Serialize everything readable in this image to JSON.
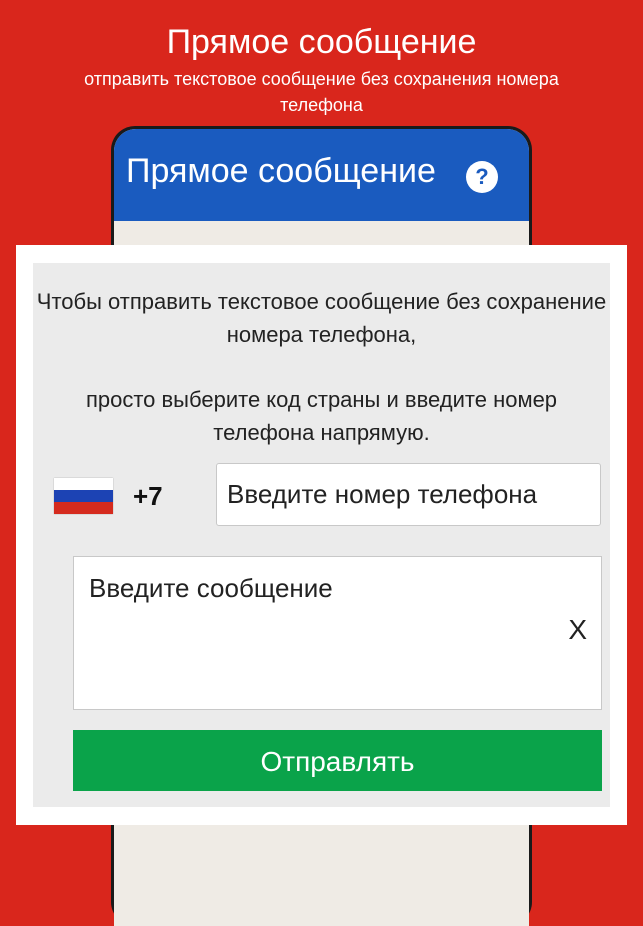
{
  "promo": {
    "title": "Прямое сообщение",
    "subtitle": "отправить текстовое сообщение без сохранения номера телефона"
  },
  "app_bar": {
    "title": "Прямое сообщение",
    "help_glyph": "?",
    "color": "#1a5bbf"
  },
  "dialog": {
    "instruction_1": "Чтобы отправить текстовое сообщение без сохранение номера телефона,",
    "instruction_2": "просто выберите код страны и введите номер телефона напрямую.",
    "country": {
      "flag_icon": "russia-flag-icon",
      "code": "+7"
    },
    "phone_input": {
      "placeholder": "Введите номер телефона",
      "value": ""
    },
    "message_input": {
      "placeholder": "Введите сообщение",
      "value": ""
    },
    "clear_label": "X",
    "send_label": "Отправлять"
  },
  "colors": {
    "background": "#d9261c",
    "send_button": "#0aa34a"
  }
}
